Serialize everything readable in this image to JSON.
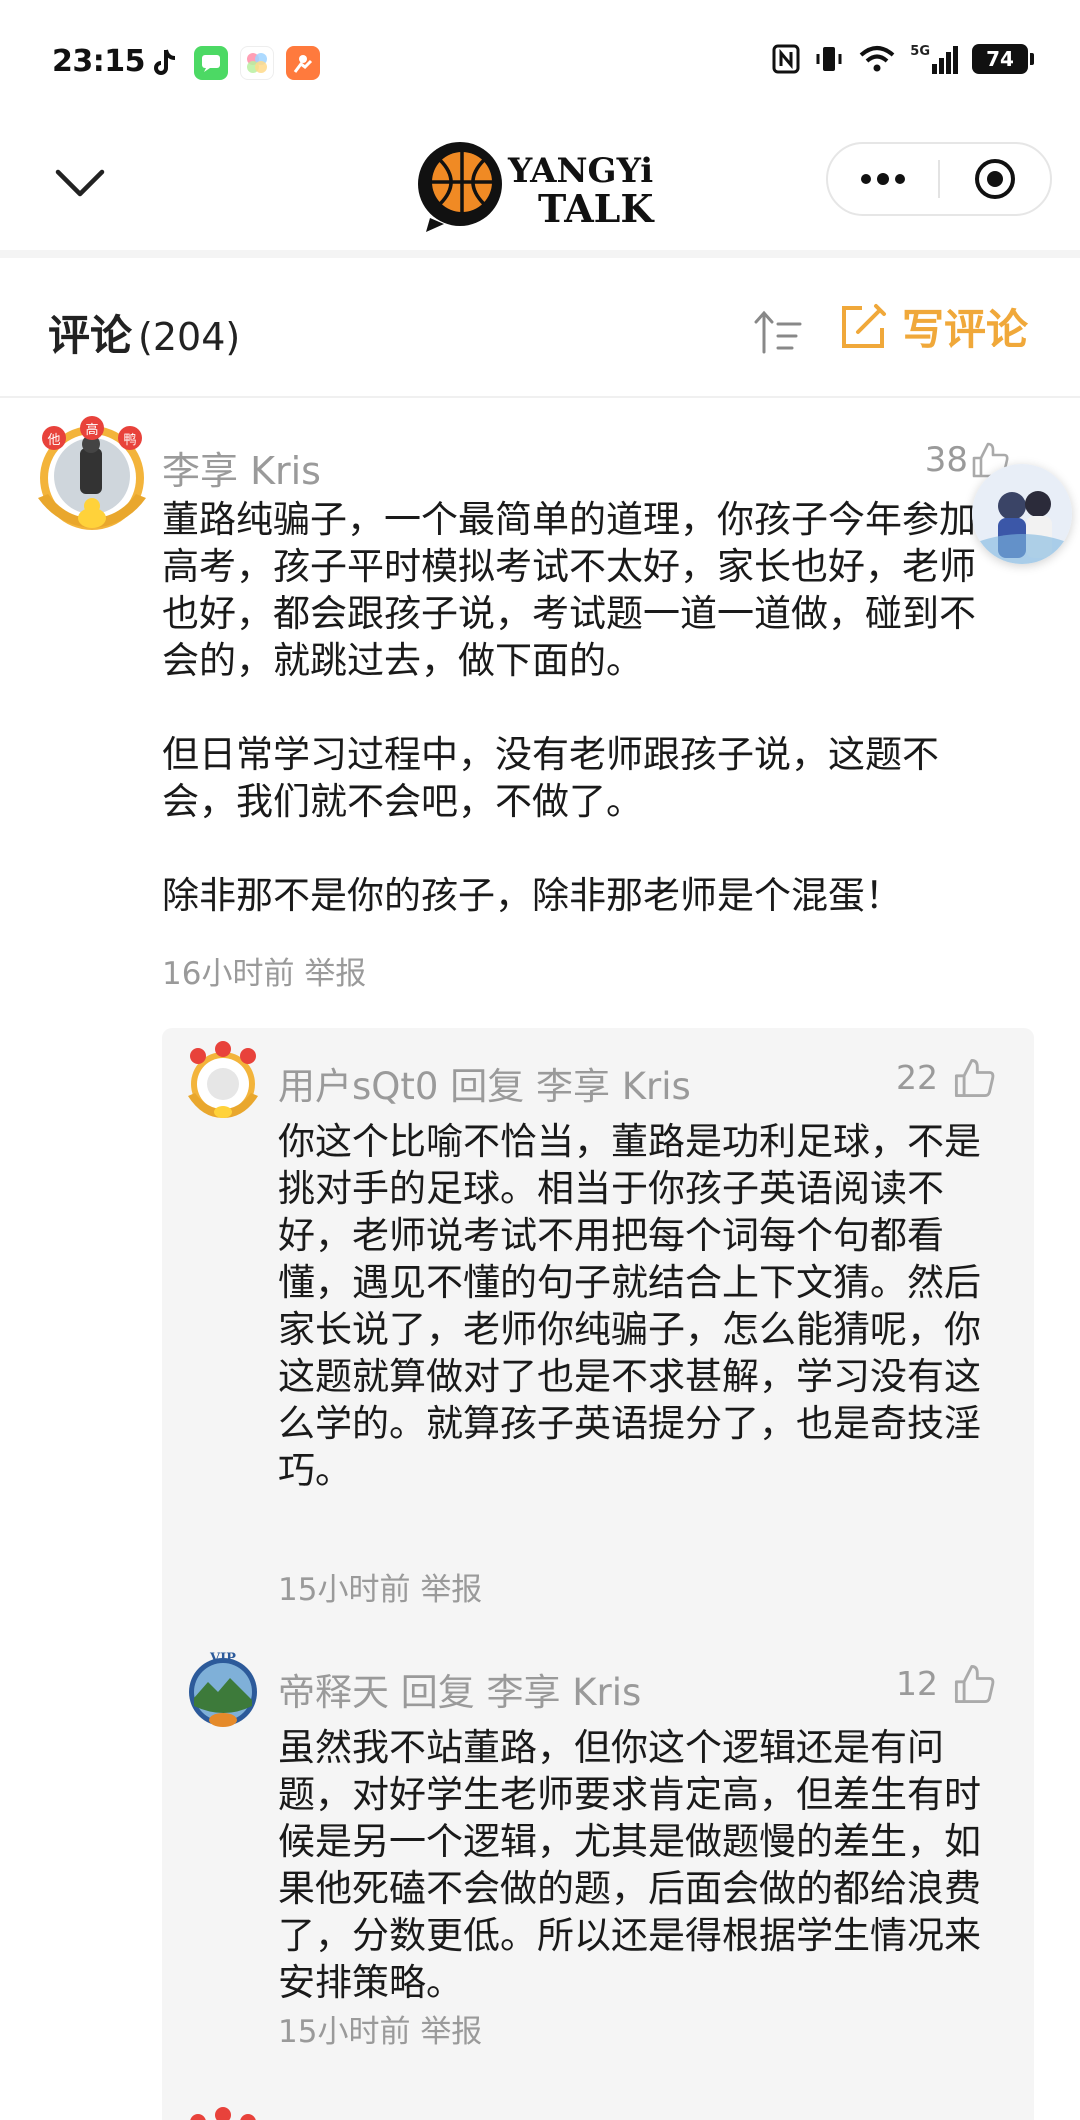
{
  "status_bar": {
    "time": "23:15",
    "network": "5G",
    "battery": "74",
    "app_icons": [
      "tiktok-icon",
      "messages-icon",
      "photos-icon",
      "weibo-icon"
    ]
  },
  "nav": {
    "logo_line1": "YANGYi",
    "logo_line2": "TALK",
    "more_icon": "more-dots-icon",
    "close_icon": "target-icon"
  },
  "comments_header": {
    "title": "评论",
    "count": "(204)",
    "write_label": "写评论",
    "accent_color": "#f0a83a"
  },
  "comment": {
    "user": "李享 Kris",
    "likes": "38",
    "text": "董路纯骗子，一个最简单的道理，你孩子今年参加高考，孩子平时模拟考试不太好，家长也好，老师也好，都会跟孩子说，考试题一道一道做，碰到不会的，就跳过去，做下面的。\n\n但日常学习过程中，没有老师跟孩子说，这题不会，我们就不会吧，不做了。\n\n除非那不是你的孩子，除非那老师是个混蛋！",
    "time": "16小时前",
    "report": "举报",
    "badge": "他高鸭"
  },
  "replies": [
    {
      "user": "用户sQt0",
      "reply_word": "回复",
      "target": "李享 Kris",
      "likes": "22",
      "text": "你这个比喻不恰当，董路是功利足球，不是挑对手的足球。相当于你孩子英语阅读不好，老师说考试不用把每个词每个句都看懂，遇见不懂的句子就结合上下文猜。然后家长说了，老师你纯骗子，怎么能猜呢，你这题就算做对了也是不求甚解，学习没有这么学的。就算孩子英语提分了，也是奇技淫巧。",
      "time": "15小时前",
      "report": "举报"
    },
    {
      "user": "帝释天",
      "reply_word": "回复",
      "target": "李享 Kris",
      "likes": "12",
      "text": "虽然我不站董路，但你这个逻辑还是有问题，对好学生老师要求肯定高，但差生有时候是另一个逻辑，尤其是做题慢的差生，如果他死磕不会做的题，后面会做的都给浪费了，分数更低。所以还是得根据学生情况来安排策略。",
      "time": "15小时前",
      "report": "举报",
      "badge": "VIP"
    }
  ]
}
